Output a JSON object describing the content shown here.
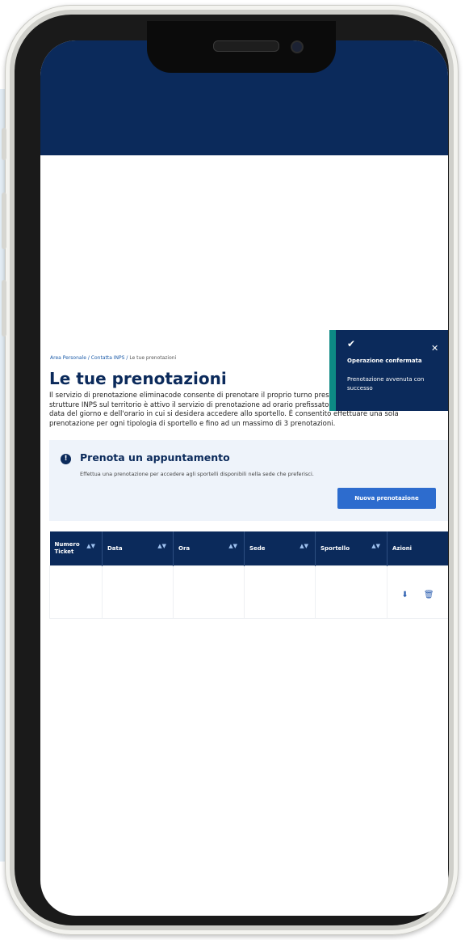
{
  "breadcrumb": {
    "items": [
      "Area Personale",
      "Contatta INPS"
    ],
    "separator": "/",
    "current": "Le tue prenotazioni"
  },
  "page": {
    "title": "Le tue prenotazioni",
    "description": "Il servizio di prenotazione eliminacode consente di prenotare il proprio turno presso gli sportelli presenti nelle strutture INPS sul territorio è attivo il servizio di prenotazione ad orario prefissato, con possibilità di scegliere la data del giorno e dell'orario in cui si desidera accedere allo sportello. È consentito effettuare una sola prenotazione per ogni tipologia di sportello e fino ad un massimo di 3 prenotazioni."
  },
  "appointment_card": {
    "icon": "info-icon",
    "icon_glyph": "!",
    "title": "Prenota un appuntamento",
    "text": "Effettua una prenotazione per accedere agli sportelli disponibili nella sede che preferisci.",
    "button_label": "Nuova prenotazione"
  },
  "table": {
    "columns": [
      {
        "label": "Numero Ticket",
        "sortable": true
      },
      {
        "label": "Data",
        "sortable": true
      },
      {
        "label": "Ora",
        "sortable": true
      },
      {
        "label": "Sede",
        "sortable": true
      },
      {
        "label": "Sportello",
        "sortable": true
      },
      {
        "label": "Azioni",
        "sortable": false
      }
    ],
    "sort_glyph": "▲▼",
    "rows": [
      {
        "numero_ticket": "",
        "data": "",
        "ora": "",
        "sede": "",
        "sportello": "",
        "actions": [
          "download-icon",
          "trash-icon"
        ]
      }
    ],
    "action_glyphs": {
      "download": "⬇",
      "delete": "🗑"
    }
  },
  "toast": {
    "check_glyph": "✔",
    "close_glyph": "✕",
    "title": "Operazione confermata",
    "message": "Prenotazione avvenuta con successo"
  },
  "colors": {
    "header_navy": "#0b2a5b",
    "primary_button": "#2d6cce",
    "toast_accent": "#0d8a85",
    "card_background": "#eef3fa"
  }
}
